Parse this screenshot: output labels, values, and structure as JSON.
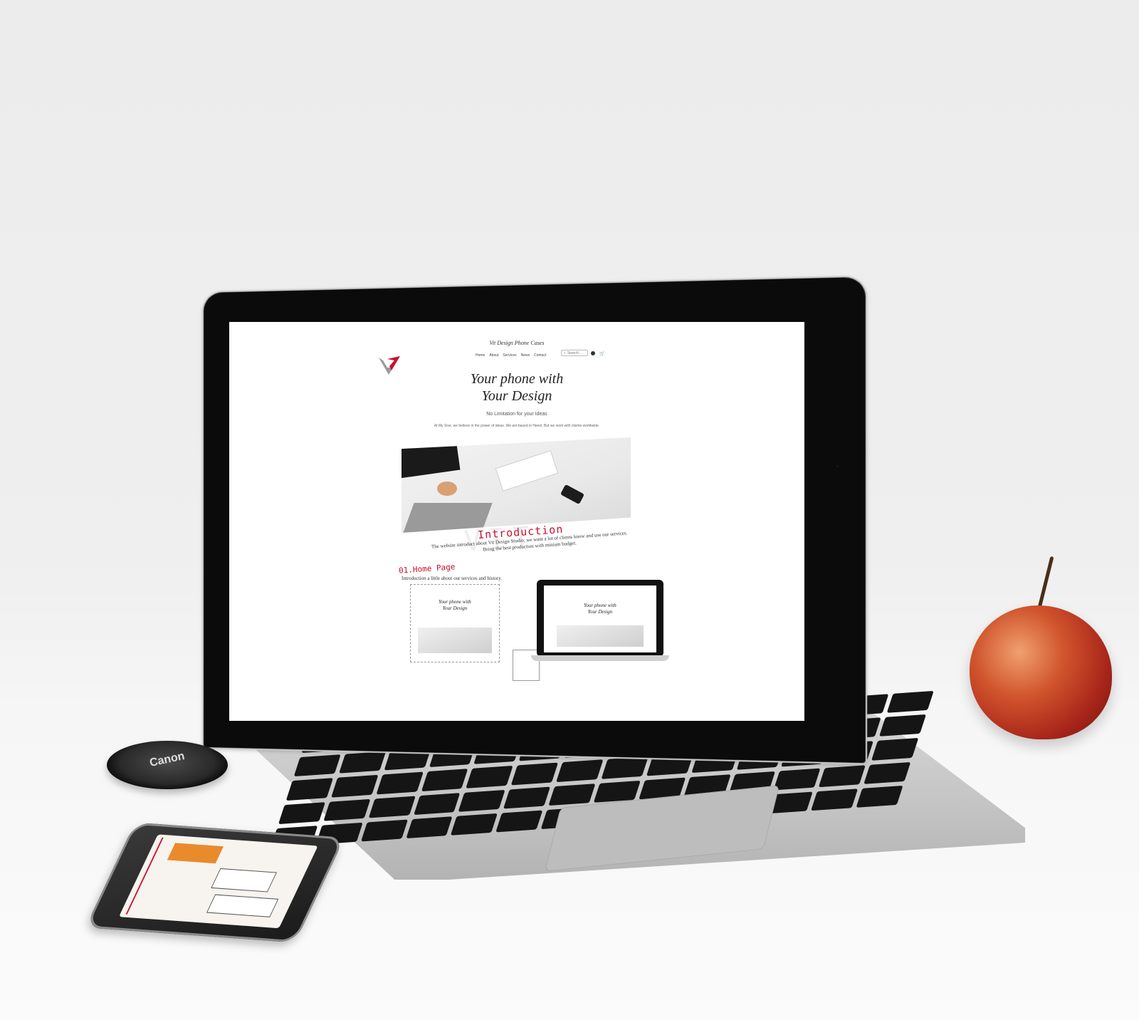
{
  "site": {
    "brand_title": "Vit Design Phone Cases",
    "nav": [
      "Home",
      "About",
      "Services",
      "News",
      "Contact"
    ],
    "search_placeholder": "Search...",
    "hero_title_line1": "Your phone with",
    "hero_title_line2": "Your Design",
    "hero_subtitle": "No Limitation for your Ideas",
    "hero_text": "At My Sive, we believe in the power of ideas. We are based in Hanoi, But we work with clients worldwide.",
    "intro_title": "Introduction",
    "intro_text_line1": "The website introduct about Vit Design Studio, we want a lot of clients know and use our services.",
    "intro_text_line2": "Bring the best production with minium budget.",
    "section_title": "01.Home Page",
    "section_text": "Introduction a little about our services and history.",
    "mini_title_line1": "Your phone with",
    "mini_title_line2": "Your Design"
  },
  "props": {
    "lens_cap_text": "Canon"
  },
  "colors": {
    "accent_red": "#c8102e",
    "cart_blue": "#2a6fbf",
    "apple_red": "#a8251a"
  },
  "icons": {
    "logo": "v-logo-icon",
    "search": "search-icon",
    "user": "user-icon",
    "cart": "cart-icon"
  }
}
